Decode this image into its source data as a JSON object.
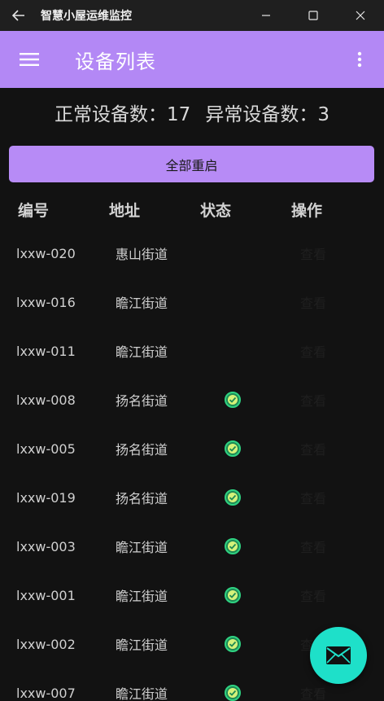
{
  "window": {
    "title": "智慧小屋运维监控",
    "back_icon": "arrow-left-icon",
    "controls": [
      "minimize-icon",
      "maximize-icon",
      "close-icon"
    ]
  },
  "appbar": {
    "title": "设备列表",
    "menu_icon": "hamburger-menu-icon",
    "more_icon": "more-vert-icon",
    "color": "#b388f5"
  },
  "stats": {
    "normal": "正常设备数：17",
    "abnormal": "异常设备数：3"
  },
  "restart_button": {
    "label": "全部重启",
    "color": "#b78bf6"
  },
  "table": {
    "headers": {
      "id": "编号",
      "address": "地址",
      "status": "状态",
      "action": "操作"
    },
    "rows": [
      {
        "id": "lxxw-020",
        "address": "惠山街道",
        "status": "abnormal",
        "action": "查看"
      },
      {
        "id": "lxxw-016",
        "address": "瞻江街道",
        "status": "abnormal",
        "action": "查看"
      },
      {
        "id": "lxxw-011",
        "address": "瞻江街道",
        "status": "abnormal",
        "action": "查看"
      },
      {
        "id": "lxxw-008",
        "address": "扬名街道",
        "status": "normal",
        "action": "查看"
      },
      {
        "id": "lxxw-005",
        "address": "扬名街道",
        "status": "normal",
        "action": "查看"
      },
      {
        "id": "lxxw-019",
        "address": "扬名街道",
        "status": "normal",
        "action": "查看"
      },
      {
        "id": "lxxw-003",
        "address": "瞻江街道",
        "status": "normal",
        "action": "查看"
      },
      {
        "id": "lxxw-001",
        "address": "瞻江街道",
        "status": "normal",
        "action": "查看"
      },
      {
        "id": "lxxw-002",
        "address": "瞻江街道",
        "status": "normal",
        "action": "查看"
      },
      {
        "id": "lxxw-007",
        "address": "瞻江街道",
        "status": "normal",
        "action": "查看"
      }
    ],
    "status_ok_color": "#2fd382"
  },
  "fab": {
    "icon": "mail-icon",
    "color": "#1ee0c9"
  }
}
